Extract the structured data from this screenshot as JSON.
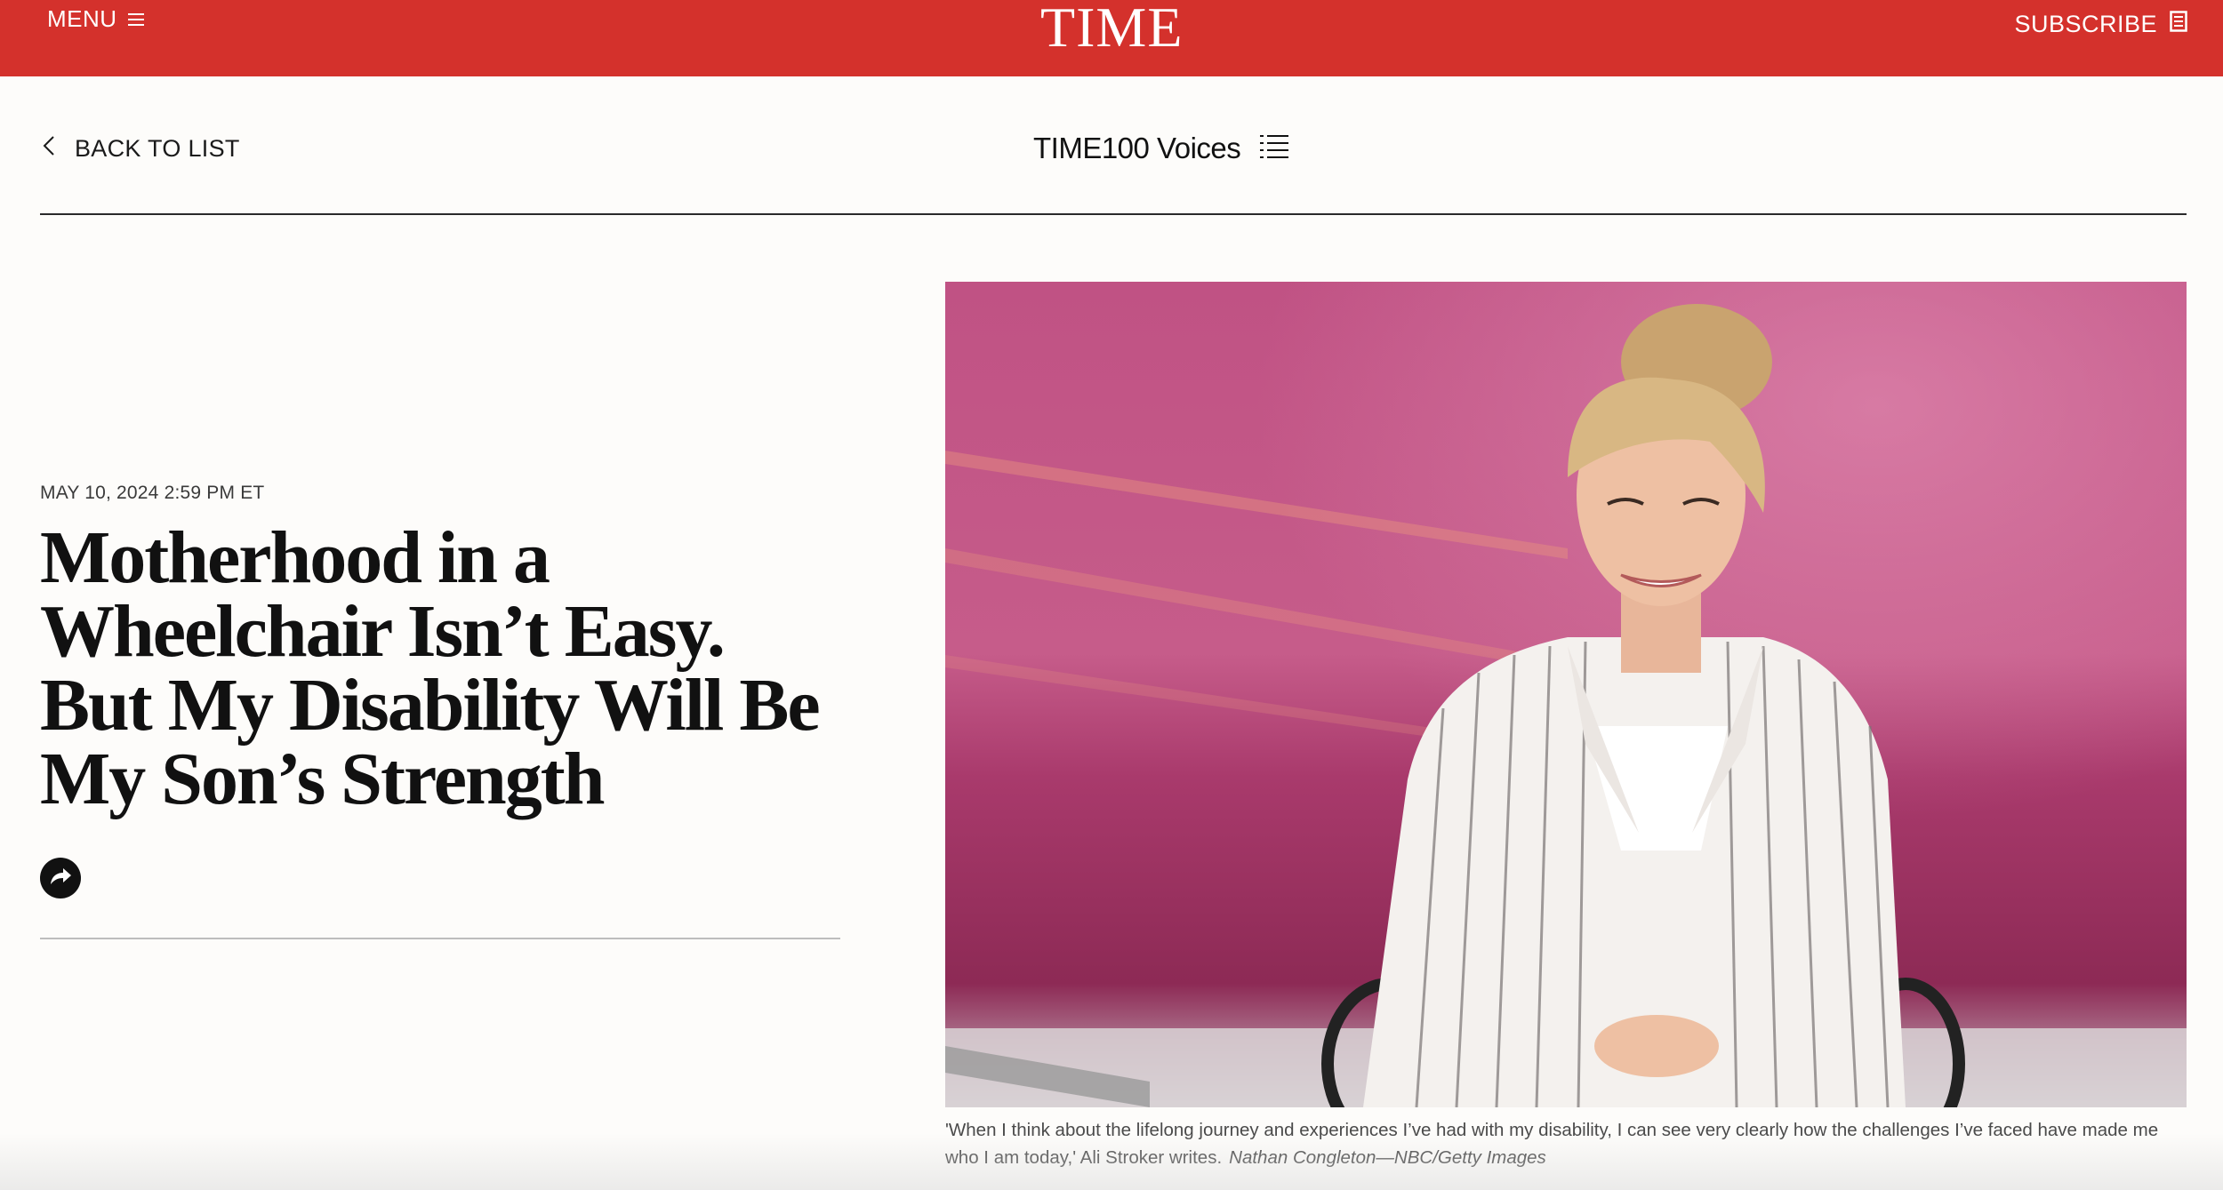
{
  "header": {
    "menu_label": "MENU",
    "logo_text": "TIME",
    "subscribe_label": "SUBSCRIBE"
  },
  "subnav": {
    "back_label": "BACK TO LIST",
    "section_title": "TIME100 Voices"
  },
  "article": {
    "dateline": "MAY 10, 2024 2:59 PM ET",
    "headline": "Motherhood in a Wheelchair Isn’t Easy. But My Disability Will Be My Son’s Strength",
    "caption": "'When I think about the lifelong journey and experiences I’ve had with my disability, I can see very clearly how the challenges I’ve faced have made me who I am today,' Ali Stroker writes.",
    "credit": "Nathan Congleton—NBC/Getty Images"
  },
  "colors": {
    "brand_red": "#d4312c",
    "page_background": "#fdfcfa",
    "text_dark": "#111111"
  },
  "icons": {
    "menu": "hamburger-icon",
    "subscribe": "magazine-icon",
    "back": "chevron-left-icon",
    "section_list": "list-icon",
    "share": "share-arrow-icon"
  }
}
